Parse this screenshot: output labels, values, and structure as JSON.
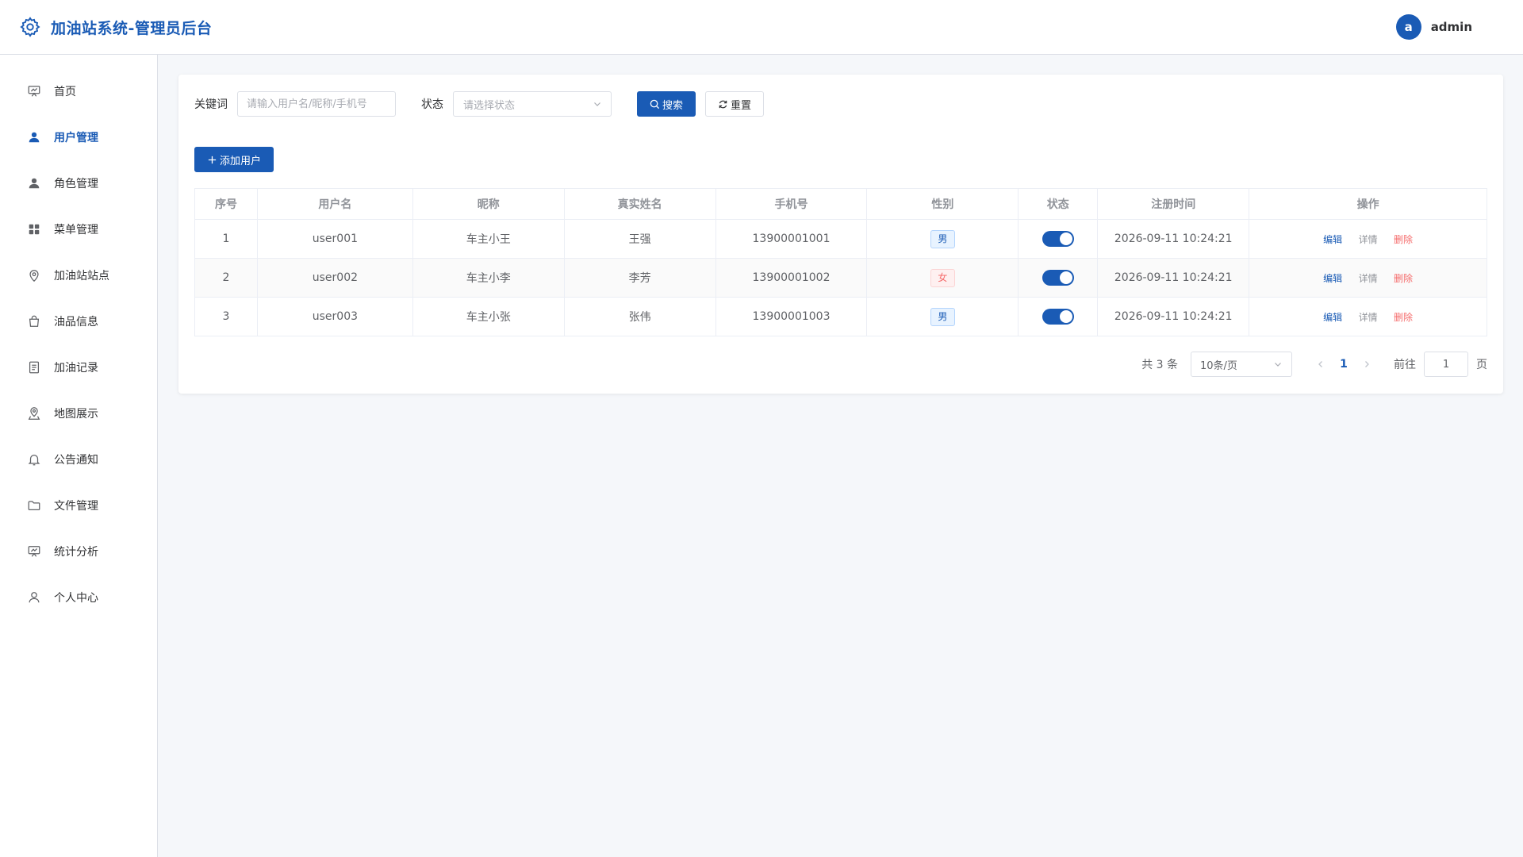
{
  "header": {
    "title": "加油站系统-管理员后台",
    "avatar_letter": "a",
    "username": "admin"
  },
  "sidebar": {
    "items": [
      {
        "label": "首页",
        "icon": "dashboard-icon"
      },
      {
        "label": "用户管理",
        "icon": "user-icon",
        "active": true
      },
      {
        "label": "角色管理",
        "icon": "role-icon"
      },
      {
        "label": "菜单管理",
        "icon": "grid-icon"
      },
      {
        "label": "加油站站点",
        "icon": "location-icon"
      },
      {
        "label": "油品信息",
        "icon": "bag-icon"
      },
      {
        "label": "加油记录",
        "icon": "document-icon"
      },
      {
        "label": "地图展示",
        "icon": "map-pin-icon"
      },
      {
        "label": "公告通知",
        "icon": "bell-icon"
      },
      {
        "label": "文件管理",
        "icon": "folder-icon"
      },
      {
        "label": "统计分析",
        "icon": "chart-icon"
      },
      {
        "label": "个人中心",
        "icon": "profile-icon"
      }
    ]
  },
  "search": {
    "keyword_label": "关键词",
    "keyword_placeholder": "请输入用户名/昵称/手机号",
    "status_label": "状态",
    "status_placeholder": "请选择状态",
    "search_button": "搜索",
    "reset_button": "重置"
  },
  "toolbar": {
    "add_button": "添加用户"
  },
  "table": {
    "columns": [
      "序号",
      "用户名",
      "昵称",
      "真实姓名",
      "手机号",
      "性别",
      "状态",
      "注册时间",
      "操作"
    ],
    "rows": [
      {
        "index": "1",
        "username": "user001",
        "nickname": "车主小王",
        "realname": "王强",
        "phone": "13900001001",
        "gender": "男",
        "enabled": true,
        "registered": "2026-09-11 10:24:21"
      },
      {
        "index": "2",
        "username": "user002",
        "nickname": "车主小李",
        "realname": "李芳",
        "phone": "13900001002",
        "gender": "女",
        "enabled": true,
        "registered": "2026-09-11 10:24:21"
      },
      {
        "index": "3",
        "username": "user003",
        "nickname": "车主小张",
        "realname": "张伟",
        "phone": "13900001003",
        "gender": "男",
        "enabled": true,
        "registered": "2026-09-11 10:24:21"
      }
    ],
    "actions": {
      "edit": "编辑",
      "detail": "详情",
      "delete": "删除"
    }
  },
  "pagination": {
    "total_text": "共 3 条",
    "page_size": "10条/页",
    "current_page": "1",
    "goto_label": "前往",
    "goto_value": "1",
    "page_suffix": "页"
  },
  "colors": {
    "primary": "#1a5bb5",
    "danger": "#f56c6c"
  }
}
